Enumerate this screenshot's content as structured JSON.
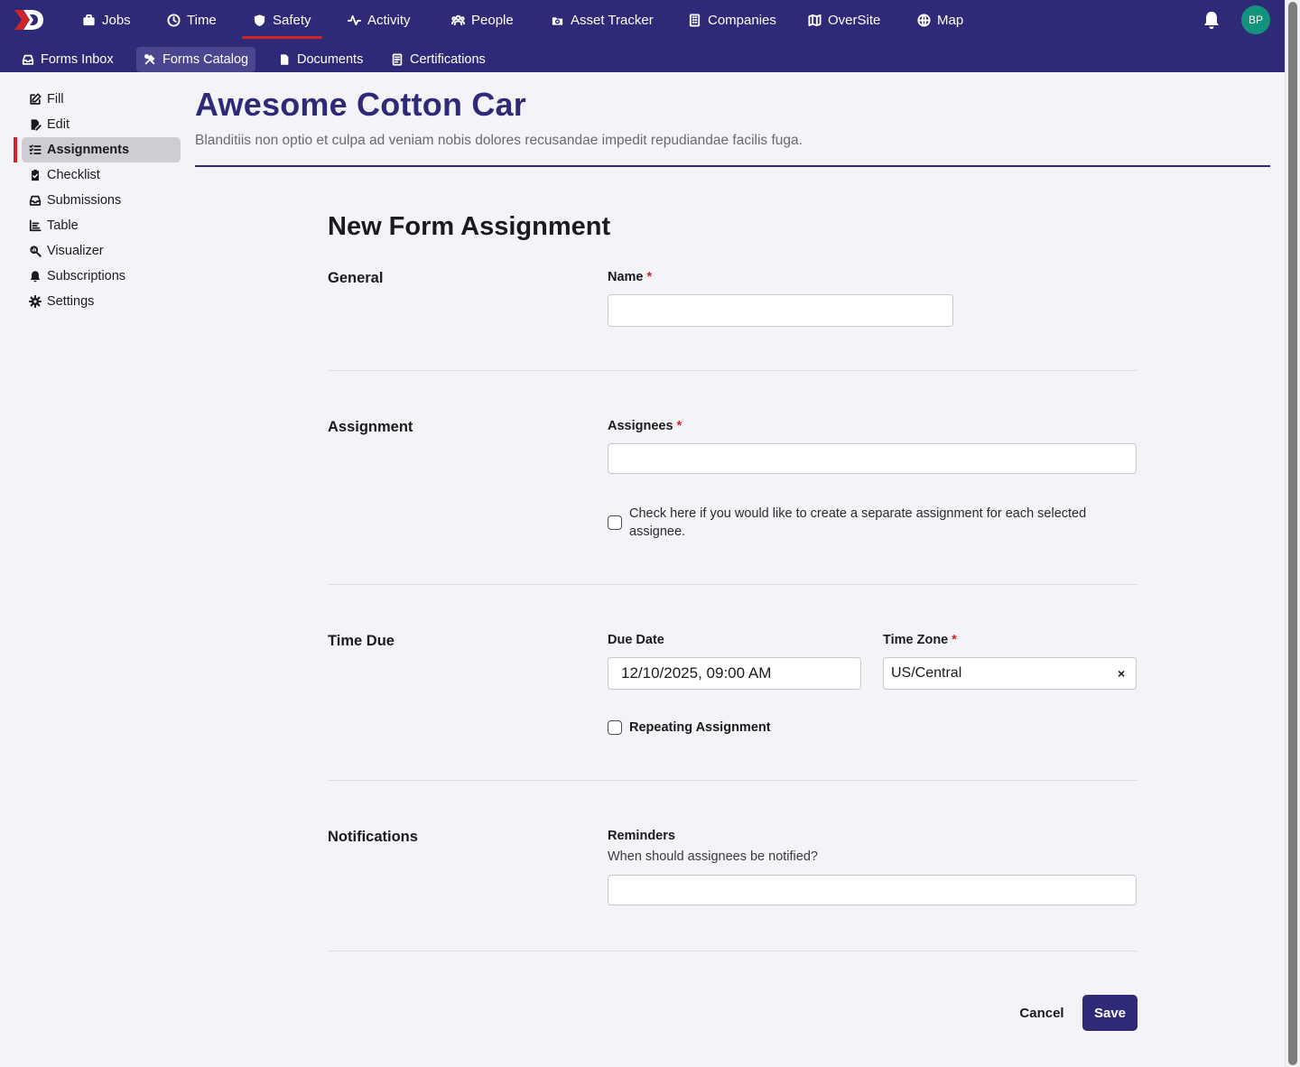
{
  "topnav": {
    "items": [
      {
        "label": "Jobs",
        "icon": "briefcase-icon"
      },
      {
        "label": "Time",
        "icon": "clock-icon"
      },
      {
        "label": "Safety",
        "icon": "shield-icon",
        "active": true
      },
      {
        "label": "Activity",
        "icon": "activity-icon"
      },
      {
        "label": "People",
        "icon": "people-icon"
      },
      {
        "label": "Asset Tracker",
        "icon": "asset-tracker-icon"
      },
      {
        "label": "Companies",
        "icon": "building-icon"
      },
      {
        "label": "OverSite",
        "icon": "map-fold-icon"
      },
      {
        "label": "Map",
        "icon": "globe-icon"
      }
    ],
    "avatar_initials": "BP"
  },
  "subnav": {
    "items": [
      {
        "label": "Forms Inbox",
        "icon": "inbox-icon"
      },
      {
        "label": "Forms Catalog",
        "icon": "tools-icon",
        "active": true
      },
      {
        "label": "Documents",
        "icon": "document-icon"
      },
      {
        "label": "Certifications",
        "icon": "certificate-icon"
      }
    ]
  },
  "sidebar": {
    "items": [
      {
        "label": "Fill",
        "icon": "edit-icon"
      },
      {
        "label": "Edit",
        "icon": "file-edit-icon"
      },
      {
        "label": "Assignments",
        "icon": "list-check-icon",
        "active": true
      },
      {
        "label": "Checklist",
        "icon": "clipboard-check-icon"
      },
      {
        "label": "Submissions",
        "icon": "inbox-icon"
      },
      {
        "label": "Table",
        "icon": "chart-table-icon"
      },
      {
        "label": "Visualizer",
        "icon": "magnify-chart-icon"
      },
      {
        "label": "Subscriptions",
        "icon": "bell-icon"
      },
      {
        "label": "Settings",
        "icon": "gear-icon"
      }
    ]
  },
  "header": {
    "title": "Awesome Cotton Car",
    "description": "Blanditiis non optio et culpa ad veniam nobis dolores recusandae impedit repudiandae facilis fuga."
  },
  "form": {
    "title": "New Form Assignment",
    "sections": {
      "general": "General",
      "assignment": "Assignment",
      "time_due": "Time Due",
      "notifications": "Notifications"
    },
    "name": {
      "label": "Name",
      "required_mark": "*",
      "value": ""
    },
    "assignees": {
      "label": "Assignees",
      "required_mark": "*",
      "value": ""
    },
    "separate_assignment_text": "Check here if you would like to create a separate assignment for each selected assignee.",
    "due_date": {
      "label": "Due Date",
      "value": "12/10/2025, 09:00 AM"
    },
    "time_zone": {
      "label": "Time Zone",
      "required_mark": "*",
      "value": "US/Central",
      "clear": "×"
    },
    "repeating_label": "Repeating Assignment",
    "reminders": {
      "label": "Reminders",
      "help": "When should assignees be notified?",
      "value": ""
    },
    "cancel_label": "Cancel",
    "save_label": "Save"
  },
  "colors": {
    "brand": "#2e2a78",
    "accent_red": "#d2232a",
    "avatar": "#13927c"
  }
}
